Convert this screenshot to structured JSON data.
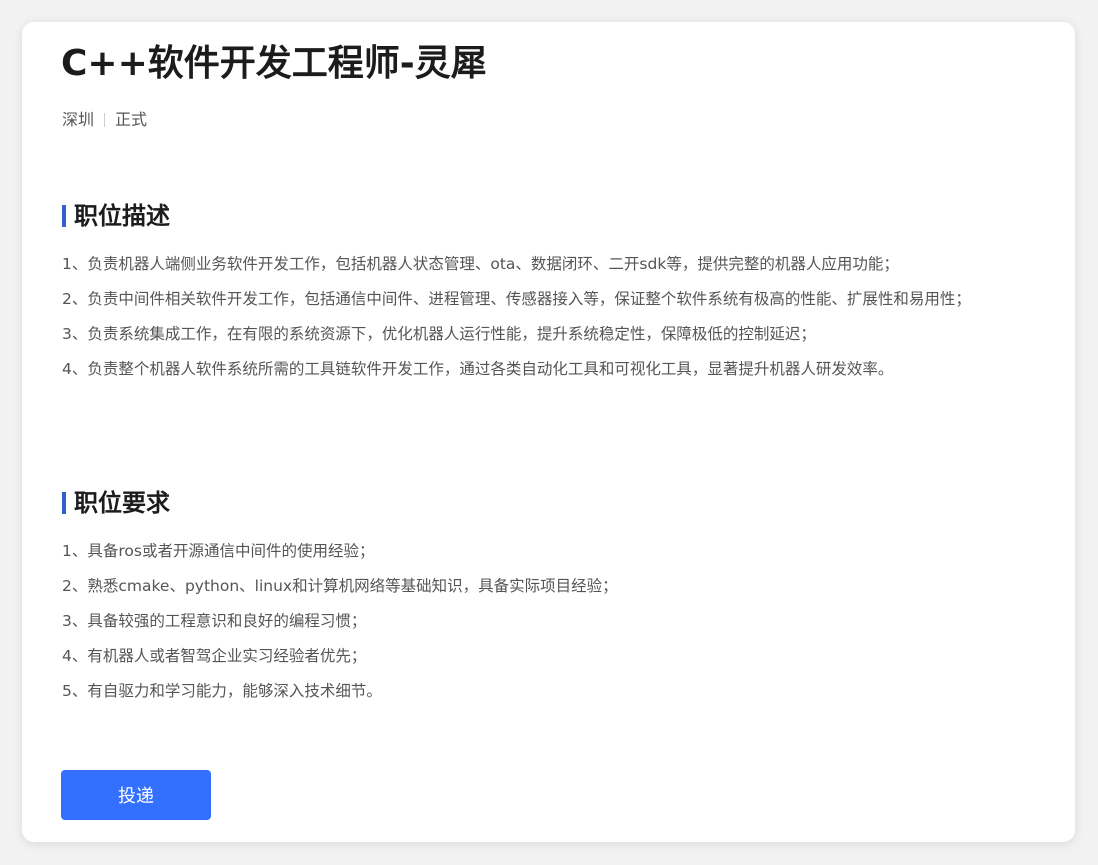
{
  "job": {
    "title": "C++软件开发工程师-灵犀",
    "location": "深圳",
    "type": "正式"
  },
  "description": {
    "heading": "职位描述",
    "items": [
      "1、负责机器人端侧业务软件开发工作，包括机器人状态管理、ota、数据闭环、二开sdk等，提供完整的机器人应用功能；",
      "2、负责中间件相关软件开发工作，包括通信中间件、进程管理、传感器接入等，保证整个软件系统有极高的性能、扩展性和易用性；",
      "3、负责系统集成工作，在有限的系统资源下，优化机器人运行性能，提升系统稳定性，保障极低的控制延迟；",
      "4、负责整个机器人软件系统所需的工具链软件开发工作，通过各类自动化工具和可视化工具，显著提升机器人研发效率。"
    ]
  },
  "requirements": {
    "heading": "职位要求",
    "items": [
      "1、具备ros或者开源通信中间件的使用经验；",
      "2、熟悉cmake、python、linux和计算机网络等基础知识，具备实际项目经验；",
      "3、具备较强的工程意识和良好的编程习惯；",
      "4、有机器人或者智驾企业实习经验者优先；",
      "5、有自驱力和学习能力，能够深入技术细节。"
    ]
  },
  "actions": {
    "apply_label": "投递"
  },
  "colors": {
    "accent": "#3370ff",
    "section_bar": "#2f5fd0"
  }
}
